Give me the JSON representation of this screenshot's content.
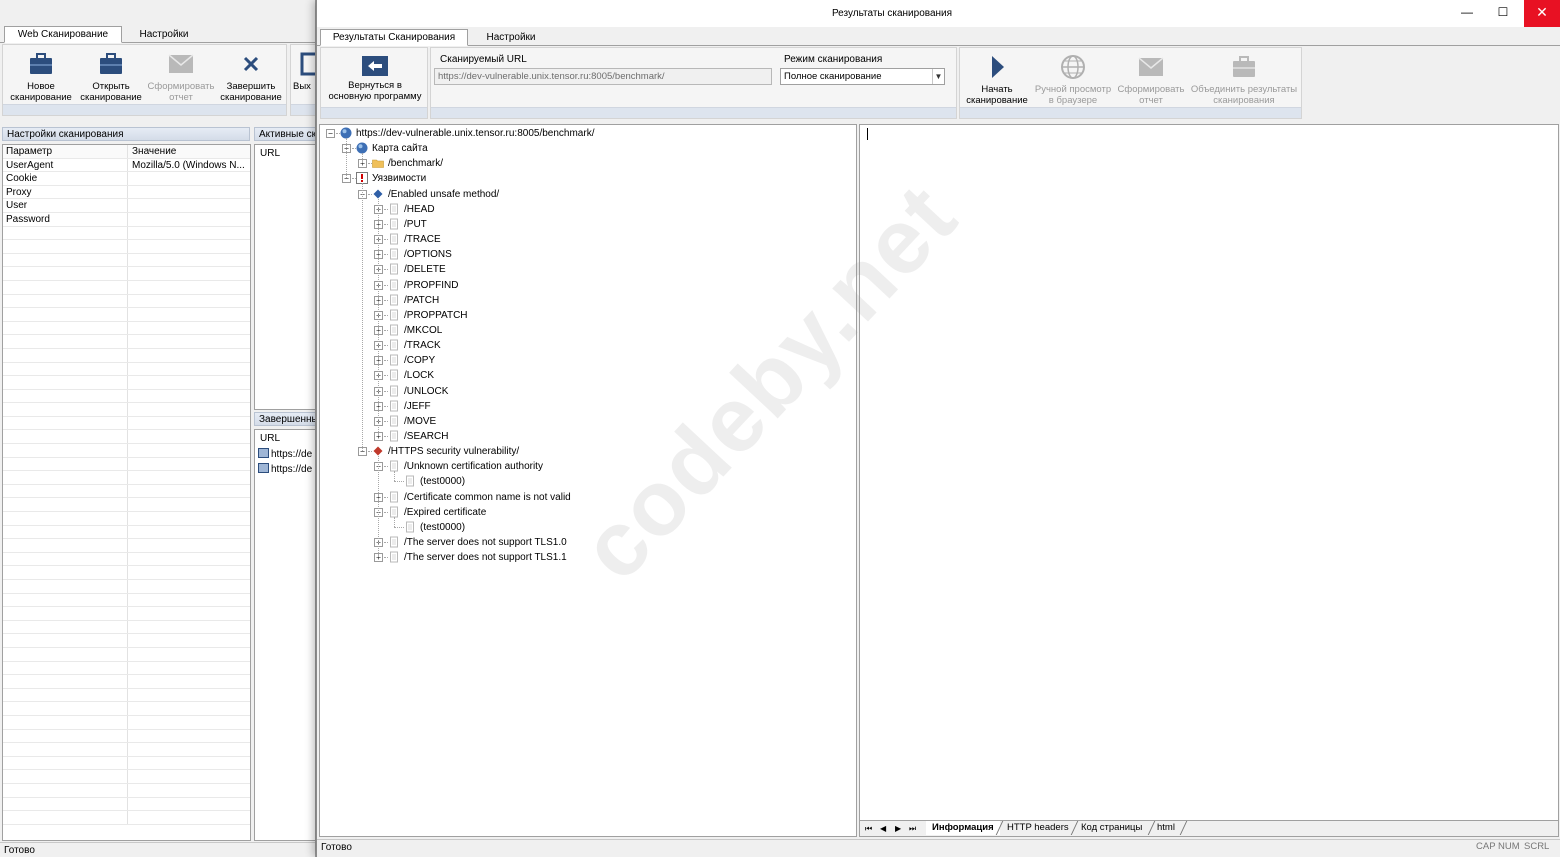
{
  "bg_window": {
    "tabs": [
      "Web Сканирование",
      "Настройки"
    ],
    "ribbon_buttons": [
      {
        "line1": "Новое",
        "line2": "сканирование",
        "icon": "briefcase-icon",
        "disabled": false
      },
      {
        "line1": "Открыть",
        "line2": "сканирование",
        "icon": "briefcase-icon",
        "disabled": false
      },
      {
        "line1": "Сформировать",
        "line2": "отчет",
        "icon": "envelope-icon",
        "disabled": true
      },
      {
        "line1": "Завершить",
        "line2": "сканирование",
        "icon": "close-x-icon",
        "disabled": false
      },
      {
        "line1": "Вых",
        "line2": "",
        "icon": "exit-icon",
        "disabled": false
      }
    ],
    "settings_panel_title": "Настройки сканирования",
    "settings_columns": [
      "Параметр",
      "Значение"
    ],
    "settings_rows": [
      {
        "param": "UserAgent",
        "value": "Mozilla/5.0 (Windows N..."
      },
      {
        "param": "Cookie",
        "value": ""
      },
      {
        "param": "Proxy",
        "value": ""
      },
      {
        "param": "User",
        "value": ""
      },
      {
        "param": "Password",
        "value": ""
      }
    ],
    "active_panel_title": "Активные ска",
    "active_column": "URL",
    "completed_panel_title": "Завершенны",
    "completed_column": "URL",
    "completed_rows": [
      "https://de",
      "https://de"
    ],
    "status": "Готово"
  },
  "fg_window": {
    "title": "Результаты сканирования",
    "controls": {
      "minimize": "—",
      "maximize": "☐",
      "close": "✕"
    },
    "tabs": [
      "Результаты Сканирования",
      "Настройки"
    ],
    "back_button": {
      "line1": "Вернуться в",
      "line2": "основную программу"
    },
    "url_label": "Сканируемый  URL",
    "url_value": "https://dev-vulnerable.unix.tensor.ru:8005/benchmark/",
    "mode_label": "Режим сканирования",
    "mode_value": "Полное сканирование",
    "action_buttons": [
      {
        "line1": "Начать",
        "line2": "сканирование",
        "icon": "play-icon",
        "disabled": false
      },
      {
        "line1": "Ручной просмотр",
        "line2": "в браузере",
        "icon": "globe-icon",
        "disabled": true
      },
      {
        "line1": "Сформировать",
        "line2": "отчет",
        "icon": "envelope-icon",
        "disabled": true
      },
      {
        "line1": "Объединить результаты",
        "line2": "сканирования",
        "icon": "briefcase-icon",
        "disabled": true
      }
    ],
    "tree": [
      {
        "label": "https://dev-vulnerable.unix.tensor.ru:8005/benchmark/",
        "level": 0,
        "icon": "globe",
        "exp": "-"
      },
      {
        "label": "Карта сайта",
        "level": 1,
        "icon": "globe",
        "exp": "-"
      },
      {
        "label": "/benchmark/",
        "level": 2,
        "icon": "folder",
        "exp": "+"
      },
      {
        "label": "Уязвимости",
        "level": 1,
        "icon": "warning",
        "exp": "-"
      },
      {
        "label": "/Enabled unsafe method/",
        "level": 2,
        "icon": "diamond-blue",
        "exp": "-"
      },
      {
        "label": "/HEAD",
        "level": 3,
        "icon": "page",
        "exp": "+"
      },
      {
        "label": "/PUT",
        "level": 3,
        "icon": "page",
        "exp": "+"
      },
      {
        "label": "/TRACE",
        "level": 3,
        "icon": "page",
        "exp": "+"
      },
      {
        "label": "/OPTIONS",
        "level": 3,
        "icon": "page",
        "exp": "+"
      },
      {
        "label": "/DELETE",
        "level": 3,
        "icon": "page",
        "exp": "+"
      },
      {
        "label": "/PROPFIND",
        "level": 3,
        "icon": "page",
        "exp": "+"
      },
      {
        "label": "/PATCH",
        "level": 3,
        "icon": "page",
        "exp": "+"
      },
      {
        "label": "/PROPPATCH",
        "level": 3,
        "icon": "page",
        "exp": "+"
      },
      {
        "label": "/MKCOL",
        "level": 3,
        "icon": "page",
        "exp": "+"
      },
      {
        "label": "/TRACK",
        "level": 3,
        "icon": "page",
        "exp": "+"
      },
      {
        "label": "/COPY",
        "level": 3,
        "icon": "page",
        "exp": "+"
      },
      {
        "label": "/LOCK",
        "level": 3,
        "icon": "page",
        "exp": "+"
      },
      {
        "label": "/UNLOCK",
        "level": 3,
        "icon": "page",
        "exp": "+"
      },
      {
        "label": "/JEFF",
        "level": 3,
        "icon": "page",
        "exp": "+"
      },
      {
        "label": "/MOVE",
        "level": 3,
        "icon": "page",
        "exp": "+"
      },
      {
        "label": "/SEARCH",
        "level": 3,
        "icon": "page",
        "exp": "+"
      },
      {
        "label": "/HTTPS security vulnerability/",
        "level": 2,
        "icon": "diamond-red",
        "exp": "-"
      },
      {
        "label": "/Unknown certification authority",
        "level": 3,
        "icon": "page",
        "exp": "-"
      },
      {
        "label": "(test0000)",
        "level": 4,
        "icon": "page",
        "exp": ""
      },
      {
        "label": "/Certificate common name is not valid",
        "level": 3,
        "icon": "page",
        "exp": "+"
      },
      {
        "label": "/Expired certificate",
        "level": 3,
        "icon": "page",
        "exp": "-"
      },
      {
        "label": "(test0000)",
        "level": 4,
        "icon": "page",
        "exp": ""
      },
      {
        "label": "/The server does not support TLS1.0",
        "level": 3,
        "icon": "page",
        "exp": "+"
      },
      {
        "label": "/The server does not support TLS1.1",
        "level": 3,
        "icon": "page",
        "exp": "+"
      }
    ],
    "bottom_tabs": [
      "Информация",
      "HTTP headers",
      "Код страницы",
      "html"
    ],
    "status": "Готово",
    "indicators": [
      "CAP",
      "NUM",
      "SCRL"
    ]
  },
  "watermark": "codeby.net",
  "colors": {
    "close_red": "#e81123",
    "diamond_blue": "#2f5fa7",
    "diamond_red": "#c0392b",
    "icon_navy": "#2c4d7d",
    "warning_red": "#d00000"
  }
}
